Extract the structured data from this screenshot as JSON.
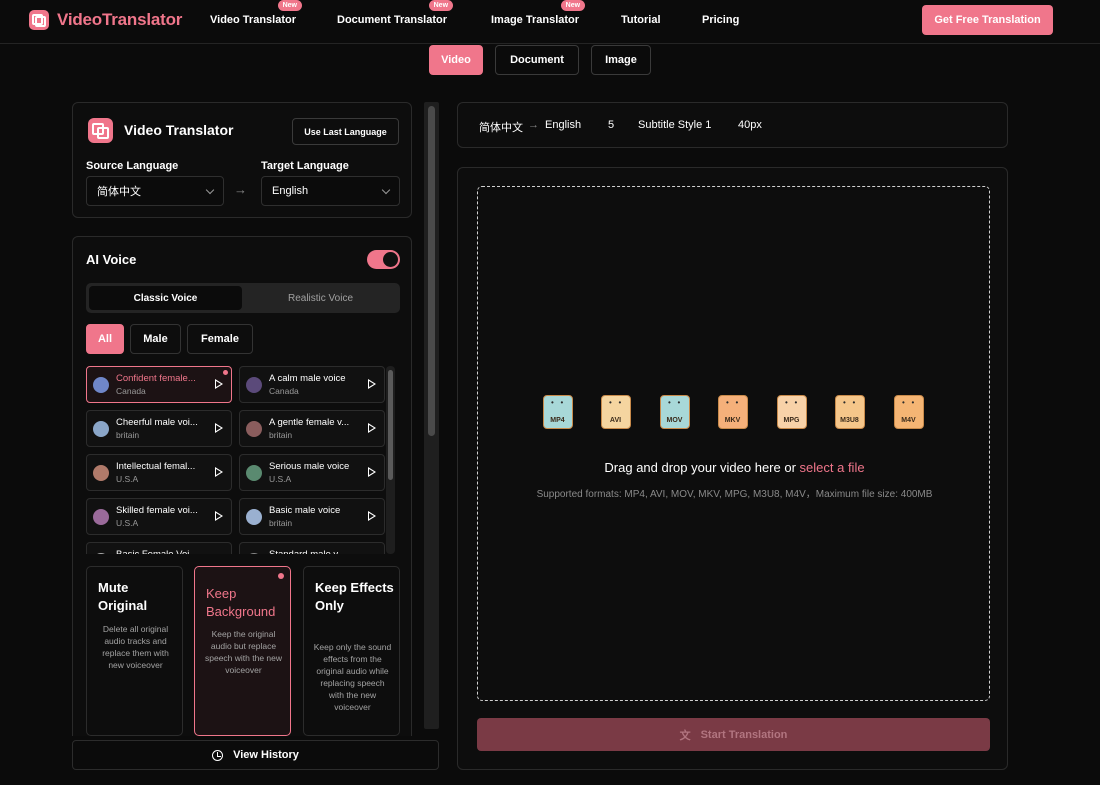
{
  "header": {
    "logo_text": "VideoTranslator",
    "nav": [
      {
        "label": "Video Translator",
        "badge": "New"
      },
      {
        "label": "Document Translator",
        "badge": "New"
      },
      {
        "label": "Image Translator",
        "badge": "New"
      },
      {
        "label": "Tutorial"
      },
      {
        "label": "Pricing"
      }
    ],
    "cta": "Get Free Translation"
  },
  "top_tabs": [
    "Video",
    "Document",
    "Image"
  ],
  "translator": {
    "title": "Video Translator",
    "use_last": "Use Last Language",
    "source_label": "Source Language",
    "source_value": "简体中文",
    "target_label": "Target Language",
    "target_value": "English",
    "arrow": "→"
  },
  "ai_voice": {
    "title": "AI Voice",
    "modes": [
      "Classic Voice",
      "Realistic Voice"
    ],
    "filters": [
      "All",
      "Male",
      "Female"
    ],
    "voices": [
      {
        "name": "Confident female...",
        "loc": "Canada",
        "color": "#6f86c9"
      },
      {
        "name": "A calm male voice",
        "loc": "Canada",
        "color": "#5b4a7a"
      },
      {
        "name": "Cheerful male voi...",
        "loc": "britain",
        "color": "#8aa6c8"
      },
      {
        "name": "A gentle female v...",
        "loc": "britain",
        "color": "#8a5d5d"
      },
      {
        "name": "Intellectual femal...",
        "loc": "U.S.A",
        "color": "#b07a6a"
      },
      {
        "name": "Serious male voice",
        "loc": "U.S.A",
        "color": "#5a8a70"
      },
      {
        "name": "Skilled female voi...",
        "loc": "U.S.A",
        "color": "#9a6a9a"
      },
      {
        "name": "Basic male voice",
        "loc": "britain",
        "color": "#9ab0d0"
      },
      {
        "name": "Basic Female Voi...",
        "loc": "",
        "color": "#aaaaaa"
      },
      {
        "name": "Standard male v...",
        "loc": "",
        "color": "#888888"
      }
    ],
    "audio_options": [
      {
        "title": "Mute Original",
        "desc": "Delete all original audio tracks and replace them with new voiceover"
      },
      {
        "title": "Keep Background",
        "desc": "Keep the original audio but replace speech with the new voiceover"
      },
      {
        "title": "Keep Effects Only",
        "desc": "Keep only the sound effects from the original audio while replacing speech with the new voiceover"
      }
    ]
  },
  "history": "View History",
  "summary": {
    "source": "简体中文",
    "arrow": "→",
    "target": "English",
    "count": "5",
    "style": "Subtitle Style 1",
    "size": "40px"
  },
  "upload": {
    "formats": [
      "MP4",
      "AVI",
      "MOV",
      "MKV",
      "MPG",
      "M3U8",
      "M4V"
    ],
    "format_colors": [
      "#a8d8d8",
      "#f5d5a0",
      "#a8d8d8",
      "#f5b07a",
      "#f8d2a8",
      "#f5c68a",
      "#f5b574"
    ],
    "drop_text": "Drag and drop your video here or ",
    "drop_link": "select a file",
    "supported": "Supported formats: MP4, AVI, MOV, MKV, MPG, M3U8, M4V，Maximum file size: 400MB",
    "start": "Start Translation"
  }
}
